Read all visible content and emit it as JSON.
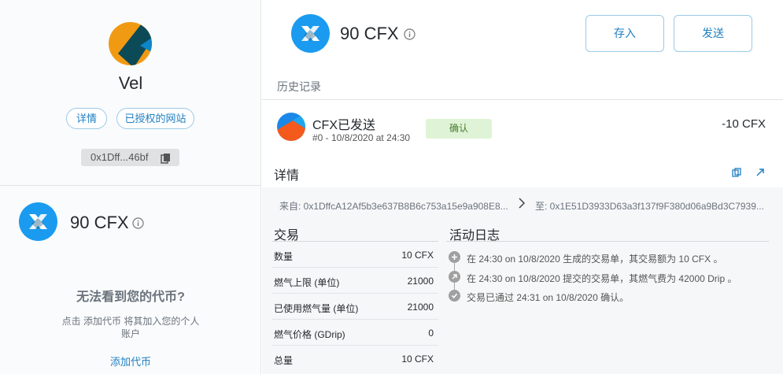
{
  "account": {
    "name": "Vel",
    "details_label": "详情",
    "authorized_sites_label": "已授权的网站",
    "address_short": "0x1Dff...46bf"
  },
  "sidebar": {
    "asset": {
      "balance": "90 CFX"
    },
    "token_help": {
      "title": "无法看到您的代币?",
      "text": "点击 添加代币 将其加入您的个人账户",
      "link": "添加代币"
    }
  },
  "main": {
    "balance": "90 CFX",
    "deposit_label": "存入",
    "send_label": "发送",
    "history_label": "历史记录"
  },
  "transaction": {
    "title": "CFX已发送",
    "subtitle": "#0 - 10/8/2020 at 24:30",
    "status": "确认",
    "amount": "-10 CFX",
    "details_heading": "详情",
    "from": "来自: 0x1DffcA12Af5b3e637B8B6c753a15e9a908E8...",
    "to": "至: 0x1E51D3933D63a3f137f9F380d06a9Bd3C7939...",
    "table_title": "交易",
    "rows": [
      {
        "label": "数量",
        "value": "10 CFX"
      },
      {
        "label": "燃气上限 (单位)",
        "value": "21000"
      },
      {
        "label": "已使用燃气量 (单位)",
        "value": "21000"
      },
      {
        "label": "燃气价格 (GDrip)",
        "value": "0"
      },
      {
        "label": "总量",
        "value": "10 CFX"
      }
    ],
    "activity_title": "活动日志",
    "activity": [
      {
        "icon": "plus-icon",
        "text": "在 24:30 on 10/8/2020 生成的交易单，其交易额为 10 CFX 。"
      },
      {
        "icon": "arrow-up-right-icon",
        "text": "在 24:30 on 10/8/2020 提交的交易单，其燃气费为 42000 Drip 。"
      },
      {
        "icon": "check-icon",
        "text": "交易已通过 24:31 on 10/8/2020 确认。"
      }
    ]
  },
  "colors": {
    "accent": "#1f7fc2",
    "status_bg": "#dff4d6",
    "cfx_blue": "#1a9bf0"
  }
}
